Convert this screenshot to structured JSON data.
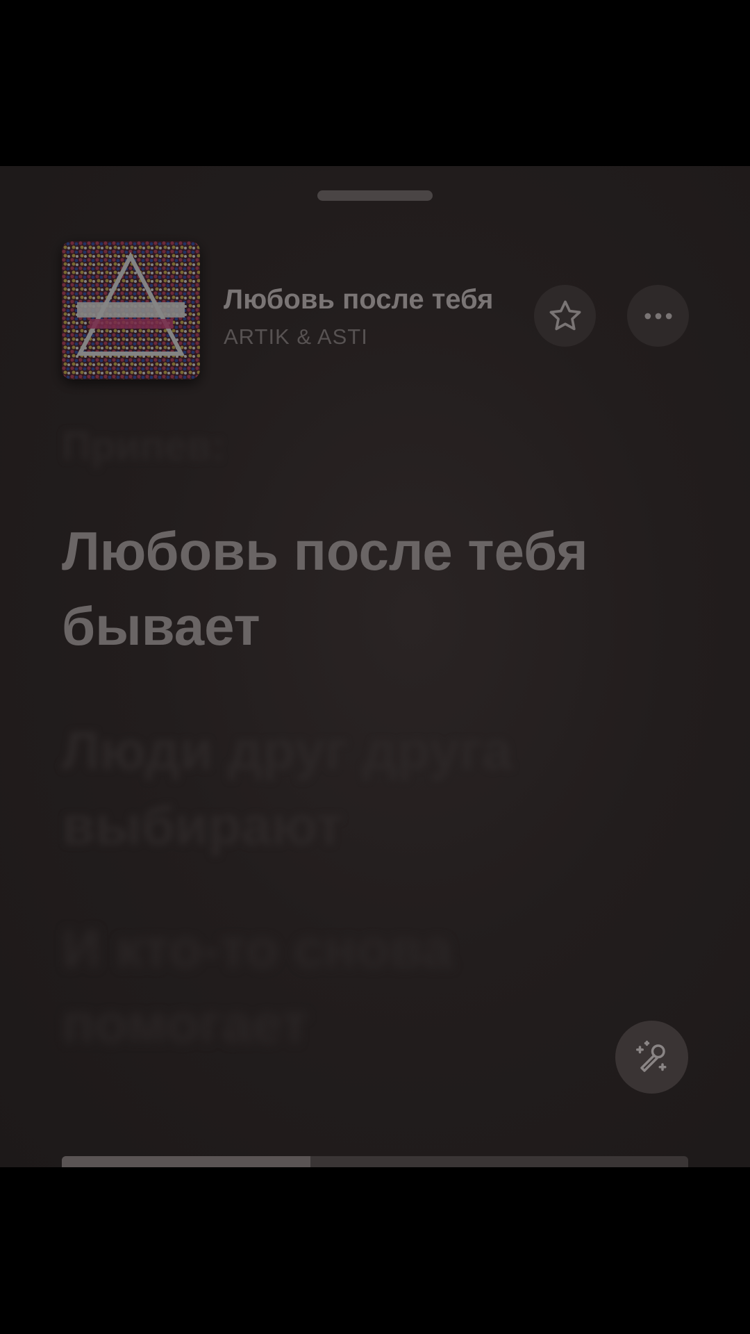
{
  "track": {
    "title": "Любовь после тебя",
    "artist": "ARTIK & ASTI"
  },
  "cover": {
    "art_text": "ARTIK & ASTI"
  },
  "lyrics": {
    "previous": "Припев:",
    "current": [
      "Любовь после тебя",
      "бывает"
    ],
    "next": [
      [
        "Люди друг друга",
        "выбирают"
      ],
      [
        "И кто-то снова",
        "помогает"
      ]
    ]
  },
  "playback": {
    "progress_fraction": 0.397
  },
  "icons": {
    "favorite": "star-outline-icon",
    "more": "ellipsis-icon",
    "karaoke": "microphone-sparkle-icon"
  },
  "colors": {
    "background": "#000000",
    "sheet": "#221d1d",
    "button": "#2e2929",
    "text_primary": "#7a7575",
    "text_secondary": "#575252"
  }
}
